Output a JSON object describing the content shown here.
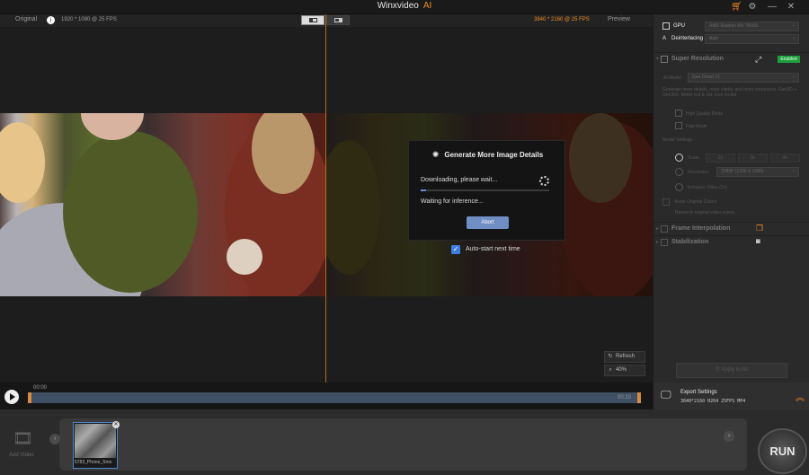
{
  "window": {
    "title": "Winxvideo",
    "title_ai": "AI"
  },
  "preview_header": {
    "original_label": "Original",
    "source_info": "1920 * 1080 @ 25 FPS",
    "output_info": "3840 * 2160 @ 25 FPS",
    "preview_label": "Preview",
    "info_icon_glyph": "i"
  },
  "dialog": {
    "title": "Generate More Image Details",
    "status_downloading": "Downloading, please wait...",
    "status_waiting": "Waiting for inference...",
    "abort_label": "Abort",
    "progress": 0.04
  },
  "autostart": {
    "label": "Auto-start next time",
    "checked": true
  },
  "side_controls": {
    "refresh_label": "Refresh",
    "zoom_label": "40%"
  },
  "panel": {
    "gpu_label": "GPU",
    "gpu_value": "AMD Radeon RX 7600S",
    "deinterlacing_label": "Deinterlacing",
    "deinterlacing_value": "Auto",
    "super_resolution": {
      "title": "Super Resolution",
      "status": "Enabled",
      "ai_model_label": "AI Model",
      "ai_model_value": "Gen Detail V1",
      "description": "Generate more details, more clarity, and more sharpness. Gen3D + Gen360. Better but & Gd. Gen model.",
      "high_quality_label": "High Quality Mode",
      "fast_label": "Fast Mode",
      "model_settings_label": "Model Settings",
      "scale_label": "Scale",
      "scale_options": [
        "2x",
        "3x",
        "4x"
      ],
      "resolution_label": "Resolution",
      "resolution_value": "1080P (1920 X 1080)",
      "enhance_label": "Enhance Video (1x)",
      "keep_colors_label": "Keep Original Colors",
      "keep_colors_desc": "Revert to original video colors"
    },
    "frame_interpolation_title": "Frame Interpolation",
    "stabilization_title": "Stabilization",
    "apply_all_label": "Apply to All"
  },
  "timeline": {
    "start_time": "00:00",
    "end_time": "00:10"
  },
  "export": {
    "title": "Export Settings",
    "details": "3840*2160  H264  25FPS  MP4"
  },
  "bottom": {
    "add_video_label": "Add Video",
    "clip_name": "5783_Phone_Smo",
    "run_label": "RUN"
  },
  "colors": {
    "accent_orange": "#f08a24",
    "enabled_green": "#1e9e3c",
    "abort_blue": "#6e8ec4",
    "checkbox_blue": "#3b7de0",
    "timeline_blue": "#3f5065"
  },
  "icons": {
    "cart": "cart-icon",
    "settings": "gear-icon",
    "minimize": "minimize-icon",
    "close": "close-icon",
    "refresh": "refresh-icon",
    "zoom": "zoom-icon"
  }
}
